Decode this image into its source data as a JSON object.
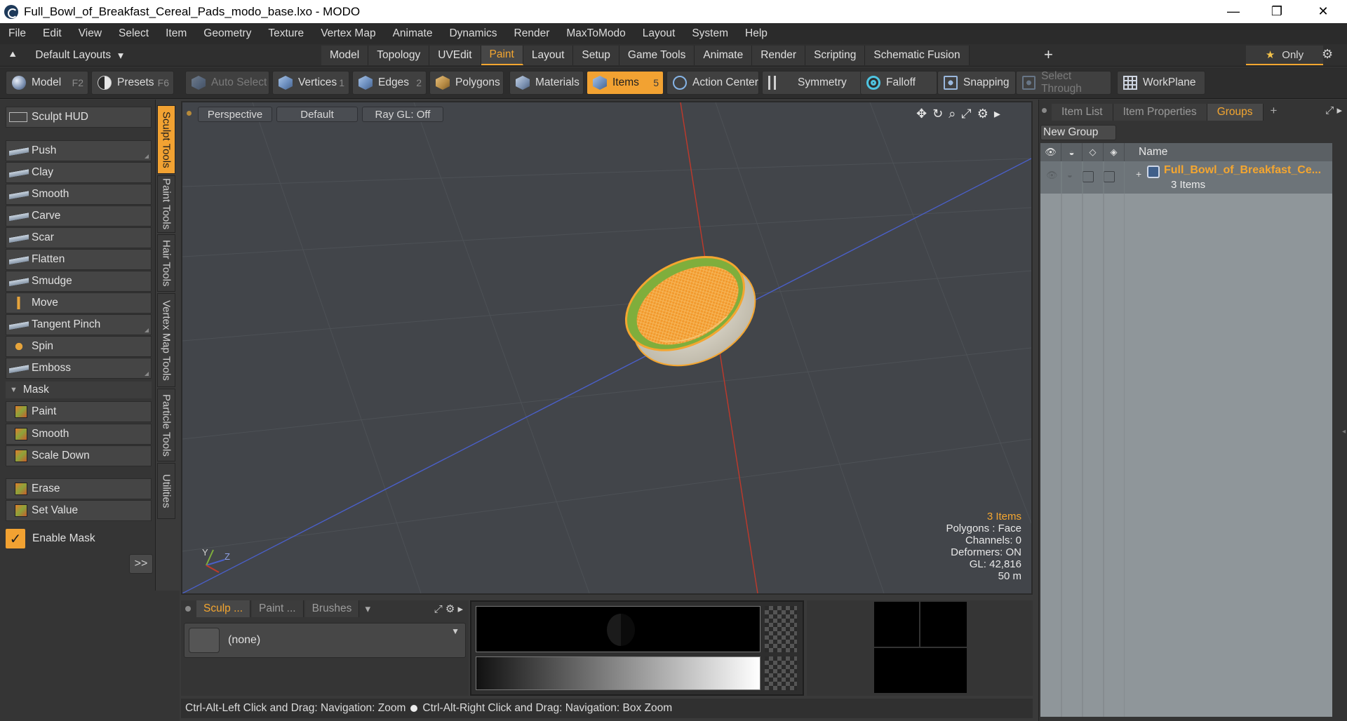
{
  "window": {
    "title": "Full_Bowl_of_Breakfast_Cereal_Pads_modo_base.lxo - MODO",
    "minimize": "—",
    "maximize": "❐",
    "close": "✕"
  },
  "menu": [
    "File",
    "Edit",
    "View",
    "Select",
    "Item",
    "Geometry",
    "Texture",
    "Vertex Map",
    "Animate",
    "Dynamics",
    "Render",
    "MaxToModo",
    "Layout",
    "System",
    "Help"
  ],
  "layout_tabs": {
    "dropdown": "Default Layouts",
    "tabs": [
      "Model",
      "Topology",
      "UVEdit",
      "Paint",
      "Layout",
      "Setup",
      "Game Tools",
      "Animate",
      "Render",
      "Scripting",
      "Schematic Fusion"
    ],
    "active": "Paint",
    "add": "+",
    "only": "Only"
  },
  "toolbar": {
    "model": "Model",
    "model_key": "F2",
    "presets": "Presets",
    "presets_key": "F6",
    "auto_select": "Auto Select",
    "vertices": "Vertices",
    "vertices_key": "1",
    "edges": "Edges",
    "edges_key": "2",
    "polygons": "Polygons",
    "materials": "Materials",
    "items": "Items",
    "items_key": "5",
    "action_center": "Action Center",
    "symmetry": "Symmetry",
    "falloff": "Falloff",
    "snapping": "Snapping",
    "select_through": "Select Through",
    "workplane": "WorkPlane"
  },
  "sculpt": {
    "hud": "Sculpt HUD",
    "tools": [
      "Push",
      "Clay",
      "Smooth",
      "Carve",
      "Scar",
      "Flatten",
      "Smudge",
      "Move",
      "Tangent Pinch",
      "Spin",
      "Emboss"
    ],
    "mask_header": "Mask",
    "mask_tools": [
      "Paint",
      "Smooth",
      "Scale Down"
    ],
    "extra_tools": [
      "Erase",
      "Set Value"
    ],
    "enable_mask": "Enable Mask",
    "more": ">>"
  },
  "side_tabs": [
    "Sculpt Tools",
    "Paint Tools",
    "Hair Tools",
    "Vertex Map Tools",
    "Particle Tools",
    "Utilities"
  ],
  "viewport": {
    "view": "Perspective",
    "shading": "Default",
    "raygl": "Ray GL: Off",
    "info": {
      "items": "3 Items",
      "polygons": "Polygons : Face",
      "channels": "Channels: 0",
      "deformers": "Deformers: ON",
      "gl": "GL: 42,816",
      "scale": "50 m"
    },
    "colors": {
      "bg": "#42454a",
      "accent": "#f4a630",
      "bowl_inner": "#7fae3c",
      "y_axis": "#c0392b",
      "x_axis": "#4a5fc7"
    }
  },
  "right_panel": {
    "tabs": [
      "Item List",
      "Item Properties",
      "Groups"
    ],
    "active": "Groups",
    "new_group": "New Group",
    "name_header": "Name",
    "group_name": "Full_Bowl_of_Breakfast_Ce...",
    "group_sub": "3 Items"
  },
  "bottom": {
    "tabs": [
      "Sculp ...",
      "Paint ...",
      "Brushes"
    ],
    "preset": "(none)"
  },
  "status": {
    "left": "Ctrl-Alt-Left Click and Drag: Navigation: Zoom",
    "right": "Ctrl-Alt-Right Click and Drag: Navigation: Box Zoom"
  }
}
